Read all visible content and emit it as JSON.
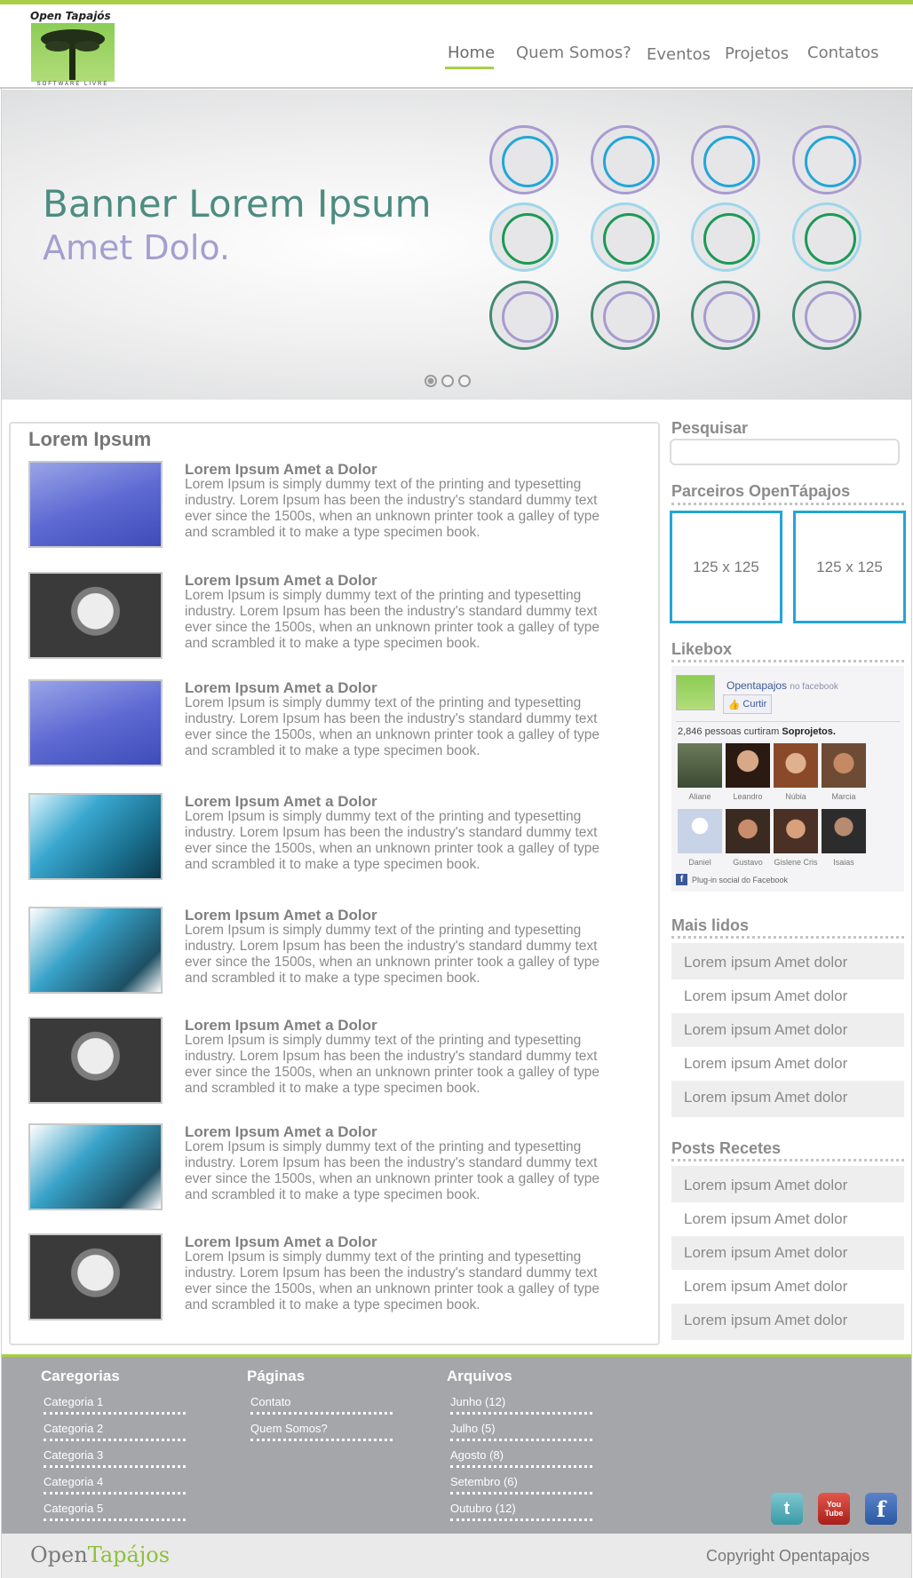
{
  "header": {
    "logo_title": "Open Tapajós",
    "logo_subtitle": "SOFTWARE LIVRE",
    "nav": [
      "Home",
      "Quem Somos?",
      "Eventos",
      "Projetos",
      "Contatos"
    ],
    "active_nav": "Home"
  },
  "banner": {
    "line1": "Banner Lorem Ipsum",
    "line2": "Amet Dolo.",
    "slide_count": 3,
    "active_slide": 1
  },
  "main": {
    "title": "Lorem Ipsum",
    "posts": [
      {
        "title": "Lorem Ipsum Amet a Dolor",
        "body": "Lorem Ipsum is simply dummy text of the printing and typesetting industry. Lorem Ipsum has been the industry's standard dummy text ever since the 1500s, when an unknown printer took a galley of type and scrambled it to make a type specimen book.",
        "thumb": "notebook"
      },
      {
        "title": "Lorem Ipsum Amet a Dolor",
        "body": "Lorem Ipsum is simply dummy text of the printing and typesetting industry. Lorem Ipsum has been the industry's standard dummy text ever since the 1500s, when an unknown printer took a galley of type and scrambled it to make a type specimen book.",
        "thumb": "robot"
      },
      {
        "title": "Lorem Ipsum Amet a Dolor",
        "body": "Lorem Ipsum is simply dummy text of the printing and typesetting industry. Lorem Ipsum has been the industry's standard dummy text ever since the 1500s, when an unknown printer took a galley of type and scrambled it to make a type specimen book.",
        "thumb": "notebook"
      },
      {
        "title": "Lorem Ipsum Amet a Dolor",
        "body": "Lorem Ipsum is simply dummy text of the printing and typesetting industry. Lorem Ipsum has been the industry's standard dummy text ever since the 1500s, when an unknown printer took a galley of type and scrambled it to make a type specimen book.",
        "thumb": "motherboard"
      },
      {
        "title": "Lorem Ipsum Amet a Dolor",
        "body": "Lorem Ipsum is simply dummy text of the printing and typesetting industry. Lorem Ipsum has been the industry's standard dummy text ever since the 1500s, when an unknown printer took a galley of type and scrambled it to make a type specimen book.",
        "thumb": "motherboard-white"
      },
      {
        "title": "Lorem Ipsum Amet a Dolor",
        "body": "Lorem Ipsum is simply dummy text of the printing and typesetting industry. Lorem Ipsum has been the industry's standard dummy text ever since the 1500s, when an unknown printer took a galley of type and scrambled it to make a type specimen book.",
        "thumb": "robot"
      },
      {
        "title": "Lorem Ipsum Amet a Dolor",
        "body": "Lorem Ipsum is simply dummy text of the printing and typesetting industry. Lorem Ipsum has been the industry's standard dummy text ever since the 1500s, when an unknown printer took a galley of type and scrambled it to make a type specimen book.",
        "thumb": "motherboard-white"
      },
      {
        "title": "Lorem Ipsum Amet a Dolor",
        "body": "Lorem Ipsum is simply dummy text of the printing and typesetting industry. Lorem Ipsum has been the industry's standard dummy text ever since the 1500s, when an unknown printer took a galley of type and scrambled it to make a type specimen book.",
        "thumb": "robot"
      }
    ]
  },
  "sidebar": {
    "search_title": "Pesquisar",
    "search_value": "",
    "partners_title": "Parceiros OpenTápajos",
    "ads": [
      "125 x 125",
      "125 x 125"
    ],
    "likebox_title": "Likebox",
    "likebox": {
      "page_name": "Opentapajos",
      "suffix": "no facebook",
      "like_label": "Curtir",
      "count_text": "2,846 pessoas curtiram",
      "page_bold": "Soprojetos.",
      "fans": [
        "Aliane",
        "Leandro",
        "Núbia",
        "Marcia",
        "Daniel",
        "Gustavo",
        "Gislene Cris",
        "Isaias"
      ],
      "plugin_text": "Plug-in social do Facebook"
    },
    "most_read_title": "Mais lidos",
    "most_read": [
      "Lorem ipsum Amet dolor",
      "Lorem ipsum Amet dolor",
      "Lorem ipsum Amet dolor",
      "Lorem ipsum Amet dolor",
      "Lorem ipsum Amet dolor"
    ],
    "recent_title": "Posts Recetes",
    "recent": [
      "Lorem ipsum Amet dolor",
      "Lorem ipsum Amet dolor",
      "Lorem ipsum Amet dolor",
      "Lorem ipsum Amet dolor",
      "Lorem ipsum Amet dolor"
    ]
  },
  "footer": {
    "categorias_title": "Caregorias",
    "categorias": [
      "Categoria 1",
      "Categoria 2",
      "Categoria 3",
      "Categoria 4",
      "Categoria 5"
    ],
    "paginas_title": "Páginas",
    "paginas": [
      "Contato",
      "Quem Somos?"
    ],
    "arquivos_title": "Arquivos",
    "arquivos": [
      "Junho (12)",
      "Julho (5)",
      "Agosto (8)",
      "Setembro (6)",
      "Outubro (12)"
    ],
    "social": [
      "twitter-icon",
      "youtube-icon",
      "facebook-icon"
    ],
    "youtube_label": "You Tube"
  },
  "bottom": {
    "brand_part1": "Open",
    "brand_part2": "Tapájos",
    "copyright": "Copyright Opentapajos"
  },
  "colors": {
    "accent_green": "#a8cf45",
    "banner_teal": "#4d8c80",
    "banner_lavender": "#a49fcf",
    "ad_border": "#23a6d8",
    "footer_bg": "#a5a6a9"
  }
}
